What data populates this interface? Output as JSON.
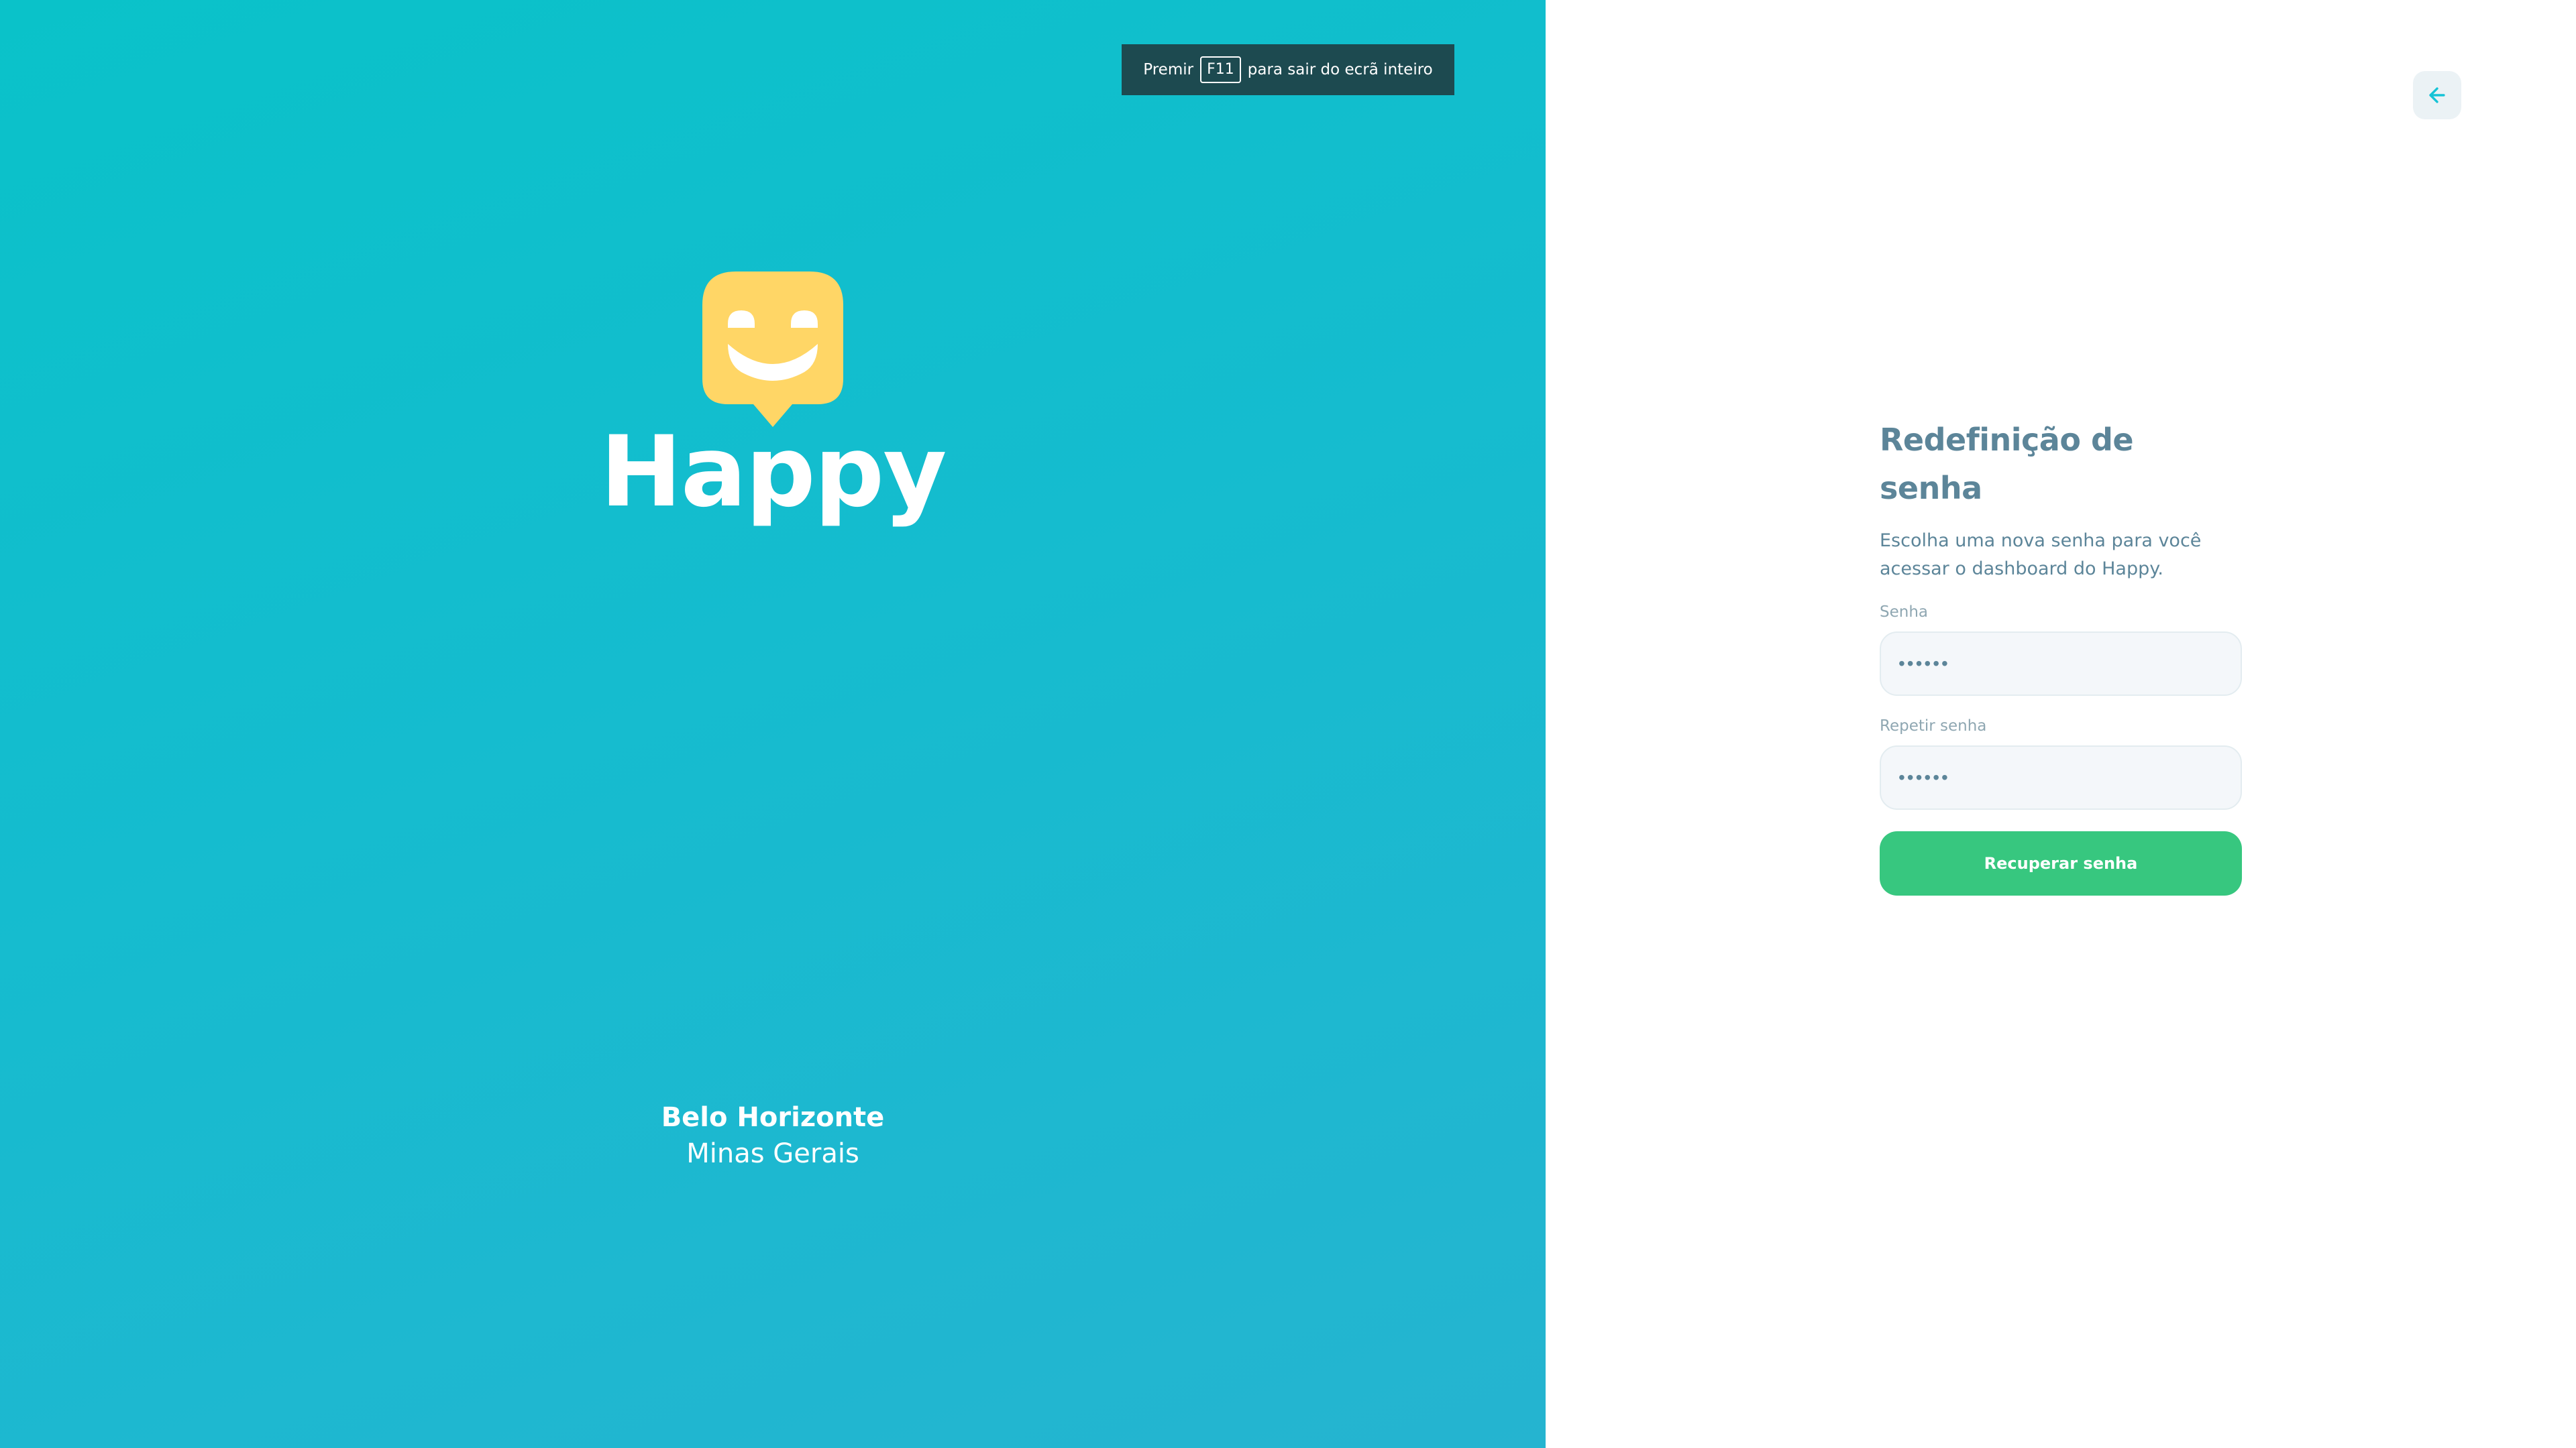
{
  "brand": {
    "name": "Happy",
    "logo_icon": "smiling-speech-bubble-icon",
    "logo_color": "#FFD666"
  },
  "location": {
    "city": "Belo Horizonte",
    "state": "Minas Gerais"
  },
  "fullscreen_notice": {
    "prefix": "Premir",
    "key": "F11",
    "suffix": "para sair do ecrã inteiro"
  },
  "back_button": {
    "icon": "arrow-left-icon"
  },
  "form": {
    "title": "Redefinição de senha",
    "description": "Escolha uma nova senha para você acessar o dashboard do Happy.",
    "password_label": "Senha",
    "password_value": "••••••",
    "repeat_password_label": "Repetir senha",
    "repeat_password_value": "••••••",
    "submit_label": "Recuperar senha"
  },
  "colors": {
    "hero_gradient_start": "#0ac2c9",
    "hero_gradient_end": "#25b4d0",
    "title_text": "#5c8599",
    "submit_button": "#37c77f",
    "back_arrow": "#15c3d6"
  }
}
